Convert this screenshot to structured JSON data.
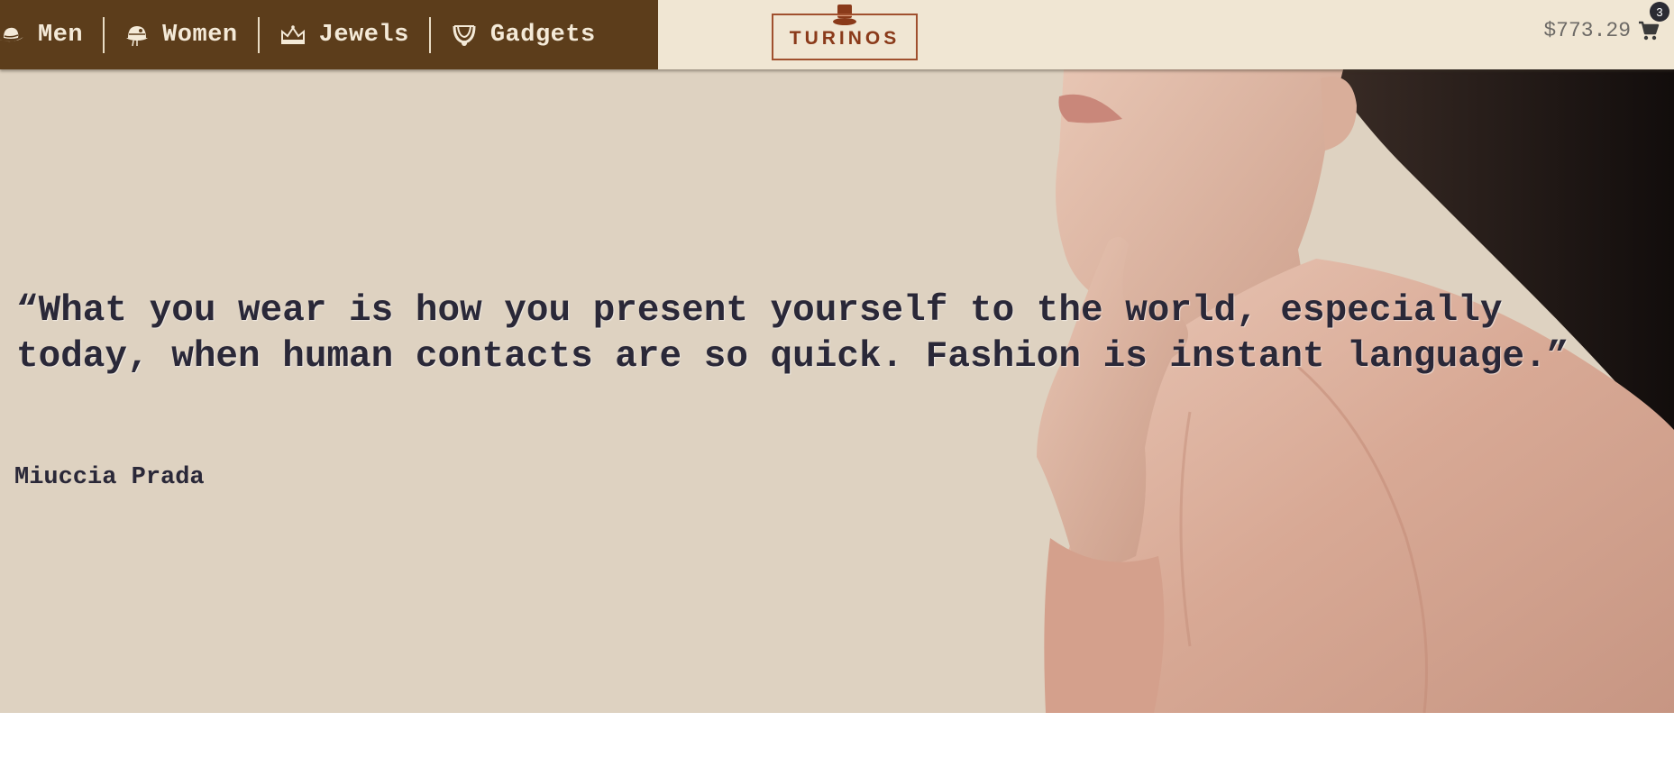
{
  "nav": {
    "items": [
      {
        "label": "Men",
        "icon": "fedora-hat-icon"
      },
      {
        "label": "Women",
        "icon": "cloche-hat-icon"
      },
      {
        "label": "Jewels",
        "icon": "crown-icon"
      },
      {
        "label": "Gadgets",
        "icon": "necklace-icon"
      }
    ]
  },
  "logo": {
    "text": "TURINOS",
    "icon": "top-hat-icon"
  },
  "cart": {
    "total": "$773.29",
    "count": "3",
    "icon": "shopping-cart-icon"
  },
  "hero": {
    "quote": "“What you wear is how you present yourself to the world, especially today, when human contacts are so quick. Fashion is instant language.”",
    "author": "Miuccia Prada"
  },
  "colors": {
    "nav_bg": "#5c3d1b",
    "header_bg": "#f0e6d3",
    "hero_bg": "#ded2c1",
    "logo_accent": "#8a3a1a",
    "text_dark": "#2a2838"
  }
}
